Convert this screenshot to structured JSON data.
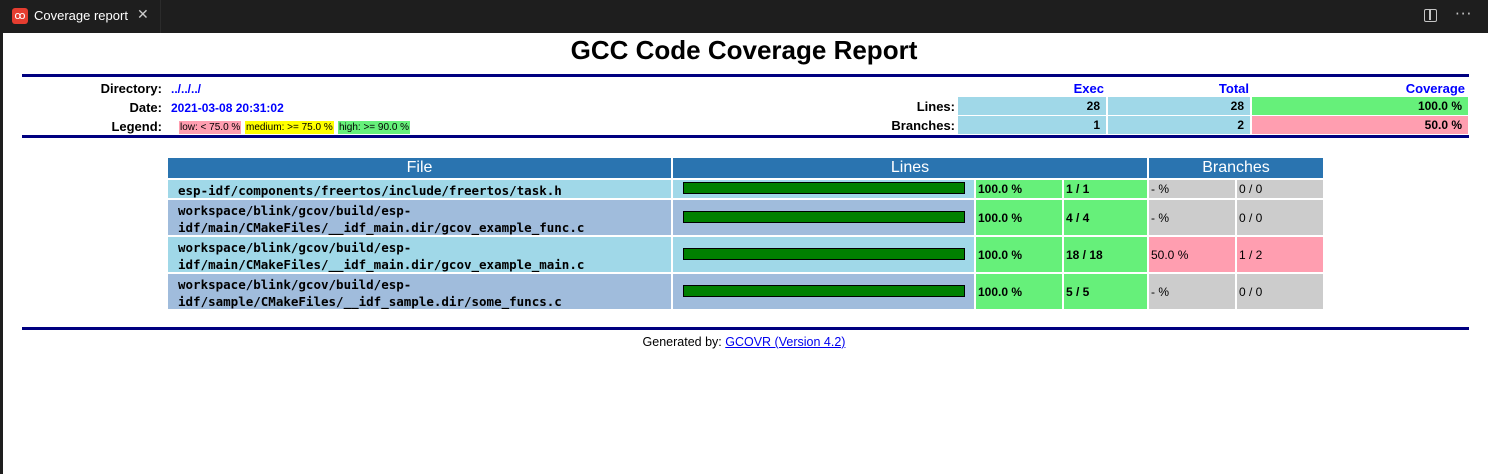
{
  "tab": {
    "label": "Coverage report",
    "close": "✕",
    "icon": "espressif-logo-icon"
  },
  "title": "GCC Code Coverage Report",
  "info": {
    "directory_label": "Directory:",
    "directory_value": "../../../",
    "date_label": "Date:",
    "date_value": "2021-03-08 20:31:02",
    "legend_label": "Legend:",
    "legend": {
      "low": "low: < 75.0 %",
      "medium": "medium: >= 75.0 %",
      "high": "high: >= 90.0 %"
    }
  },
  "summary": {
    "headers": {
      "exec": "Exec",
      "total": "Total",
      "coverage": "Coverage"
    },
    "lines": {
      "label": "Lines:",
      "exec": "28",
      "total": "28",
      "coverage": "100.0 %"
    },
    "branches": {
      "label": "Branches:",
      "exec": "1",
      "total": "2",
      "coverage": "50.0 %"
    }
  },
  "table": {
    "headers": {
      "file": "File",
      "lines": "Lines",
      "branches": "Branches"
    },
    "rows": [
      {
        "file": "esp-idf/components/freertos/include/freertos/task.h",
        "line_fraction": 1.0,
        "line_pct": "100.0 %",
        "line_count": "1 / 1",
        "branch_pct": "- %",
        "branch_count": "0 / 0"
      },
      {
        "file": "workspace/blink/gcov/build/esp-\nidf/main/CMakeFiles/__idf_main.dir/gcov_example_func.c",
        "line_fraction": 1.0,
        "line_pct": "100.0 %",
        "line_count": "4 / 4",
        "branch_pct": "- %",
        "branch_count": "0 / 0"
      },
      {
        "file": "workspace/blink/gcov/build/esp-\nidf/main/CMakeFiles/__idf_main.dir/gcov_example_main.c",
        "line_fraction": 1.0,
        "line_pct": "100.0 %",
        "line_count": "18 / 18",
        "branch_pct": "50.0 %",
        "branch_count": "1 / 2"
      },
      {
        "file": "workspace/blink/gcov/build/esp-\nidf/sample/CMakeFiles/__idf_sample.dir/some_funcs.c",
        "line_fraction": 1.0,
        "line_pct": "100.0 %",
        "line_count": "5 / 5",
        "branch_pct": "- %",
        "branch_count": "0 / 0"
      }
    ]
  },
  "footer": {
    "prefix": "Generated by: ",
    "link": "GCOVR (Version 4.2)"
  },
  "colors": {
    "low": "#ff9eb0",
    "medium": "#ffff00",
    "high": "#66f07a",
    "neutral": "#cccccc",
    "header_blue": "#2a74b0",
    "row_light": "#a0d8e8",
    "row_dark": "#a0bcdc",
    "rule": "#000080"
  }
}
